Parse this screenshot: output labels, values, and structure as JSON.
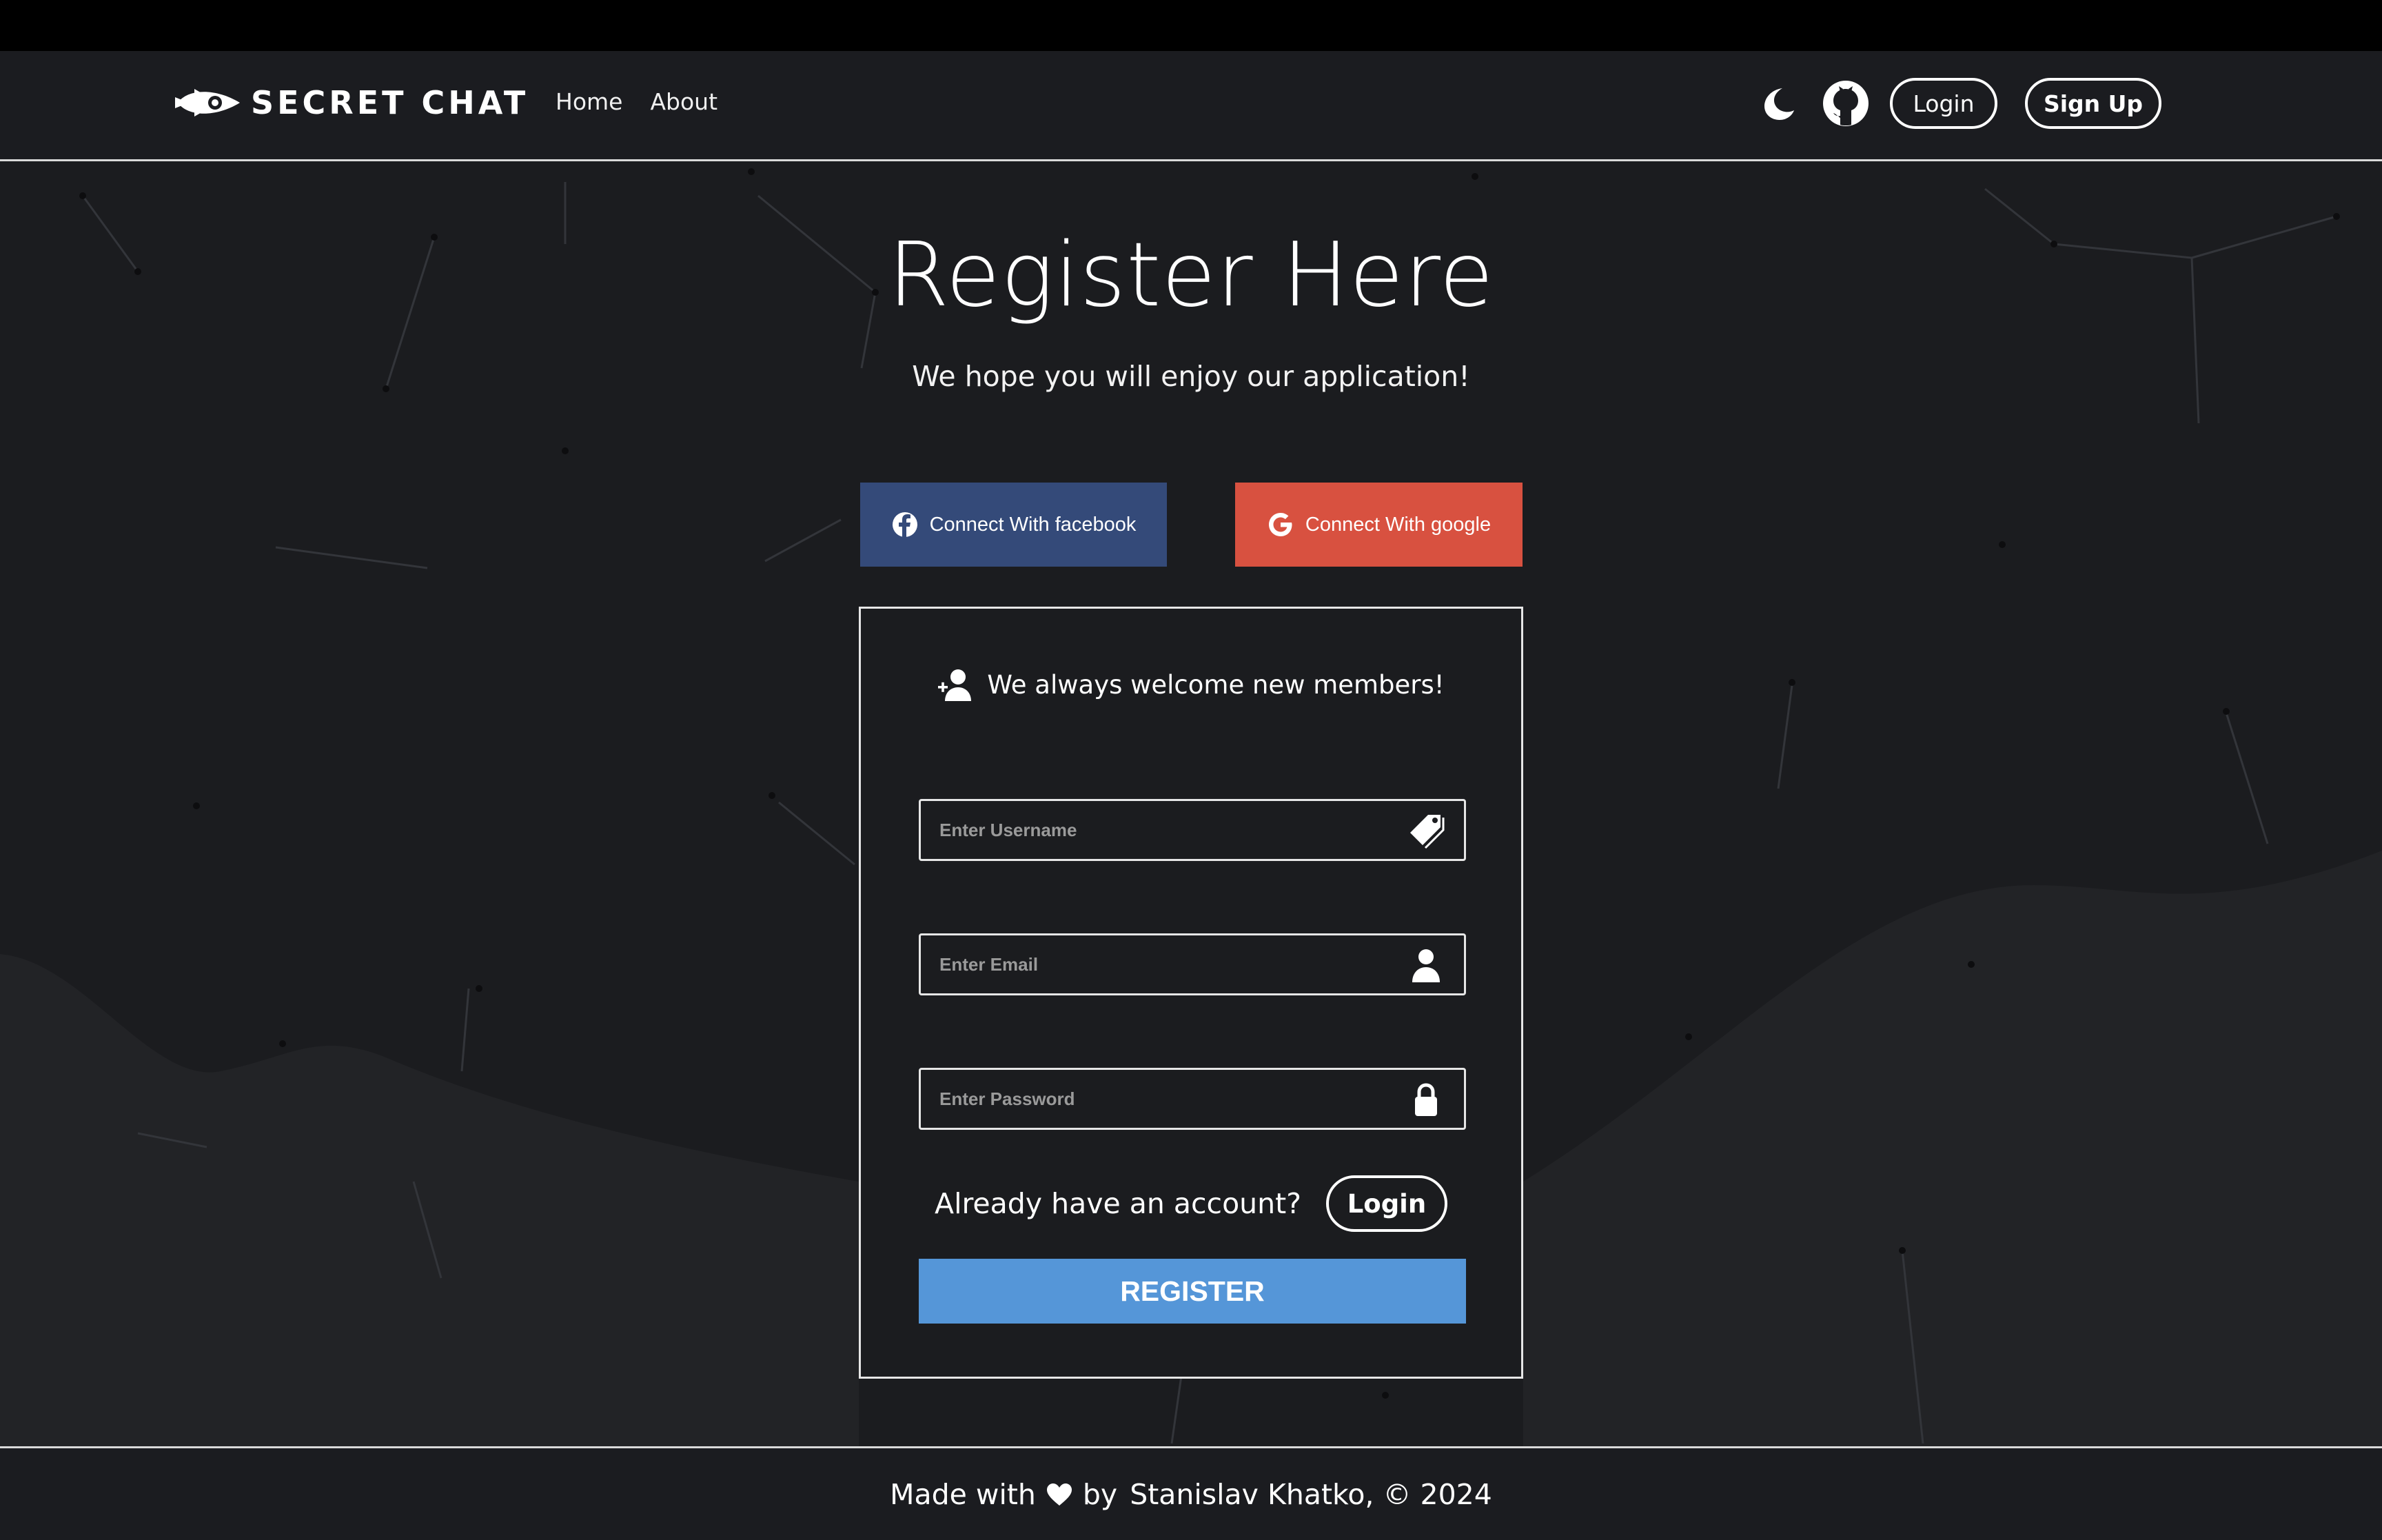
{
  "navbar": {
    "brand": "SECRET CHAT",
    "links": [
      "Home",
      "About"
    ],
    "login_label": "Login",
    "signup_label": "Sign Up"
  },
  "hero": {
    "title": "Register Here",
    "subtitle": "We hope you will enjoy our application!"
  },
  "social": {
    "facebook_label": "Connect With facebook",
    "google_label": "Connect With google",
    "facebook_color": "#344a79",
    "google_color": "#d85140"
  },
  "form": {
    "heading": "We always welcome new members!",
    "username_placeholder": "Enter Username",
    "email_placeholder": "Enter Email",
    "password_placeholder": "Enter Password",
    "have_account_text": "Already have an account?",
    "login_label": "Login",
    "register_label": "REGISTER",
    "register_color": "#5596d8"
  },
  "footer": {
    "made_with": "Made with",
    "by": "by",
    "author": "Stanislav Khatko, © 2024"
  },
  "icons": {
    "brand": "rocket-eye-icon",
    "theme": "moon-icon",
    "repo": "github-icon",
    "facebook": "facebook-icon",
    "google": "google-icon",
    "heading": "add-user-icon",
    "username": "tag-icon",
    "email": "user-icon",
    "password": "lock-icon",
    "footer": "heart-icon"
  }
}
